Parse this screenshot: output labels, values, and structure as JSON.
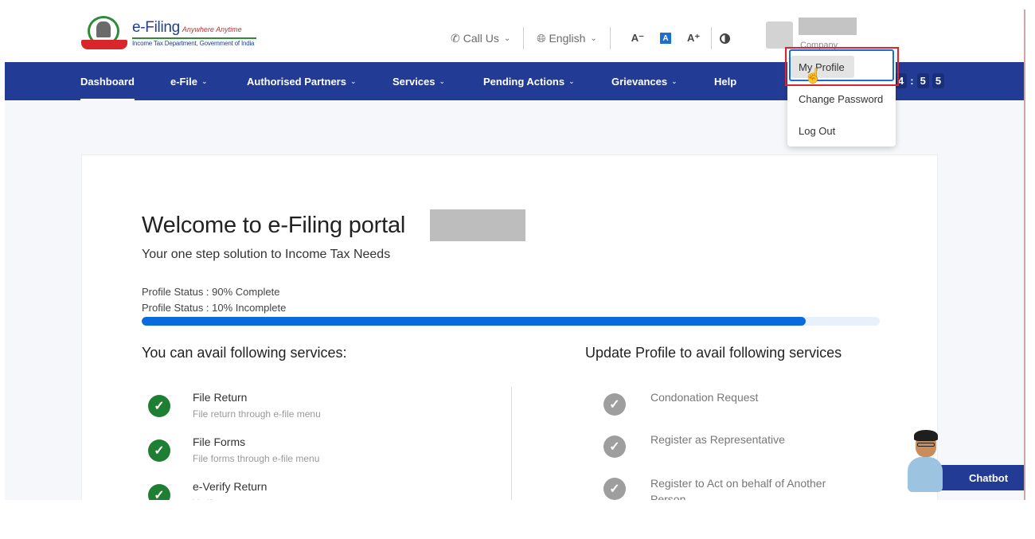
{
  "header": {
    "logo": {
      "brand": "e-Filing",
      "tagline": "Anywhere Anytime",
      "subtitle": "Income Tax Department, Government of India"
    },
    "tools": {
      "call_us": "Call Us",
      "language": "English",
      "font_decrease": "A⁻",
      "font_normal": "A",
      "font_increase": "A⁺"
    },
    "user": {
      "role": "Company"
    }
  },
  "nav": {
    "items": [
      {
        "label": "Dashboard",
        "has_dropdown": false,
        "active": true
      },
      {
        "label": "e-File",
        "has_dropdown": true
      },
      {
        "label": "Authorised Partners",
        "has_dropdown": true
      },
      {
        "label": "Services",
        "has_dropdown": true
      },
      {
        "label": "Pending Actions",
        "has_dropdown": true
      },
      {
        "label": "Grievances",
        "has_dropdown": true
      },
      {
        "label": "Help",
        "has_dropdown": false
      }
    ],
    "session_timer": [
      "4",
      ":",
      "5",
      "5"
    ]
  },
  "user_menu": {
    "items": [
      {
        "label": "My Profile"
      },
      {
        "label": "Change Password"
      },
      {
        "label": "Log Out"
      }
    ]
  },
  "main": {
    "welcome": "Welcome to e-Filing portal",
    "tagline": "Your one step solution to Income Tax Needs",
    "profile_status_complete": "Profile Status : 90% Complete",
    "profile_status_incomplete": "Profile Status : 10% Incomplete",
    "profile_progress_percent": 90,
    "available": {
      "title": "You can avail following services:",
      "services": [
        {
          "title": "File Return",
          "subtitle": "File return through e-file menu"
        },
        {
          "title": "File Forms",
          "subtitle": "File forms through e-file menu"
        },
        {
          "title": "e-Verify Return",
          "subtitle": "Verify your return"
        }
      ]
    },
    "update": {
      "title": "Update Profile to avail following services",
      "services": [
        {
          "title": "Condonation Request"
        },
        {
          "title": "Register as Representative"
        },
        {
          "title": "Register to Act on behalf of Another Person"
        }
      ]
    }
  },
  "chatbot": {
    "label": "Chatbot"
  },
  "colors": {
    "nav_bg": "#223c96",
    "progress": "#0a6cdc",
    "available_check": "#1e7e34",
    "locked_check": "#9e9e9e",
    "highlight": "#d8262b"
  }
}
